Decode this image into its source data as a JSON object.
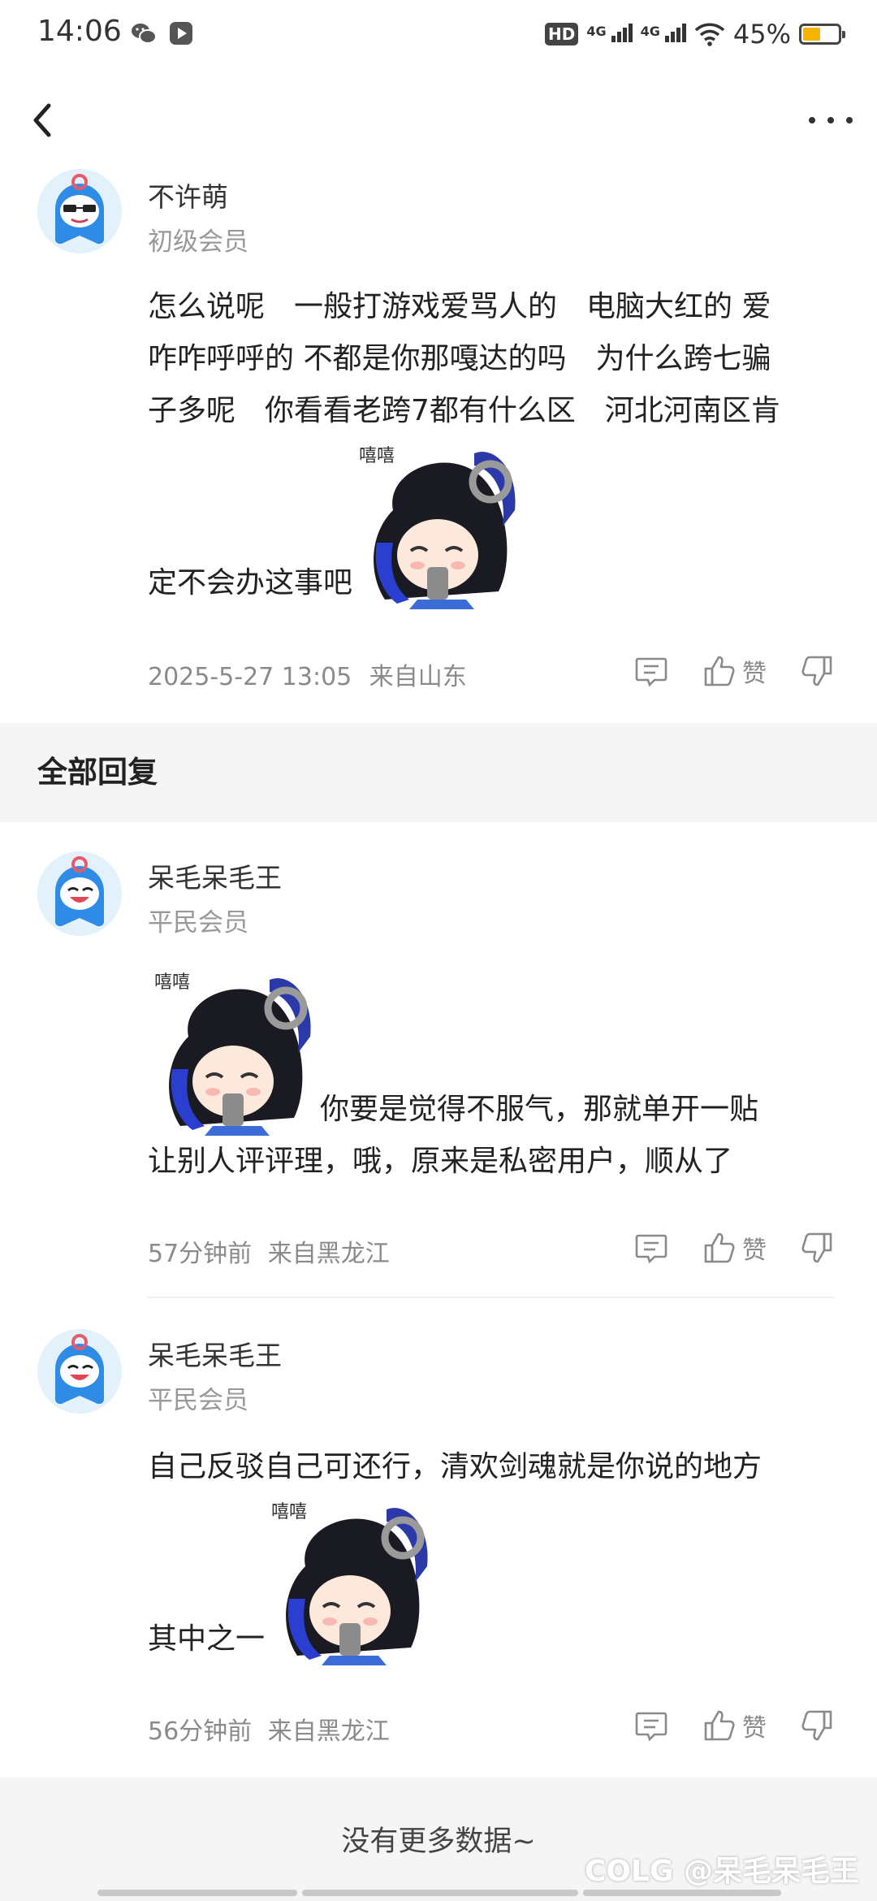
{
  "status_bar": {
    "time": "14:06",
    "hd_label": "HD",
    "net1_label": "4G",
    "net2_label": "4G",
    "battery_text": "45%",
    "battery_level": 0.45,
    "battery_color": "#f5b400"
  },
  "nav": {
    "back_icon": "chevron-left-icon",
    "more_icon": "more-horizontal-icon"
  },
  "main_post": {
    "username": "不许萌",
    "rank": "初级会员",
    "text_lines": [
      "怎么说呢　一般打游戏爱骂人的　电脑大红的 爱",
      "咋咋呼呼的 不都是你那嘎达的吗　为什么跨七骗",
      "子多呢　你看看老跨7都有什么区　河北河南区肯"
    ],
    "text_tail": "定不会办这事吧",
    "timestamp": "2025-5-27 13:05",
    "location": "来自山东",
    "like_label": "赞"
  },
  "section": {
    "title": "全部回复"
  },
  "replies": [
    {
      "username": "呆毛呆毛王",
      "rank": "平民会员",
      "text_after_sticker": "你要是觉得不服气，那就单开一贴",
      "text_line2": "让别人评评理，哦，原来是私密用户，顺从了",
      "timestamp": "57分钟前",
      "location": "来自黑龙江",
      "like_label": "赞"
    },
    {
      "username": "呆毛呆毛王",
      "rank": "平民会员",
      "text_line1": "自己反驳自己可还行，清欢剑魂就是你说的地方",
      "text_tail": "其中之一",
      "timestamp": "56分钟前",
      "location": "来自黑龙江",
      "like_label": "赞"
    }
  ],
  "sticker": {
    "caption": "嘻嘻"
  },
  "footer": {
    "text": "没有更多数据~",
    "watermark": "COLG @呆毛呆毛王"
  },
  "colors": {
    "accent_blue": "#1f6fd6",
    "meta_gray": "#8a8a8a",
    "band_gray": "#f5f5f5"
  }
}
